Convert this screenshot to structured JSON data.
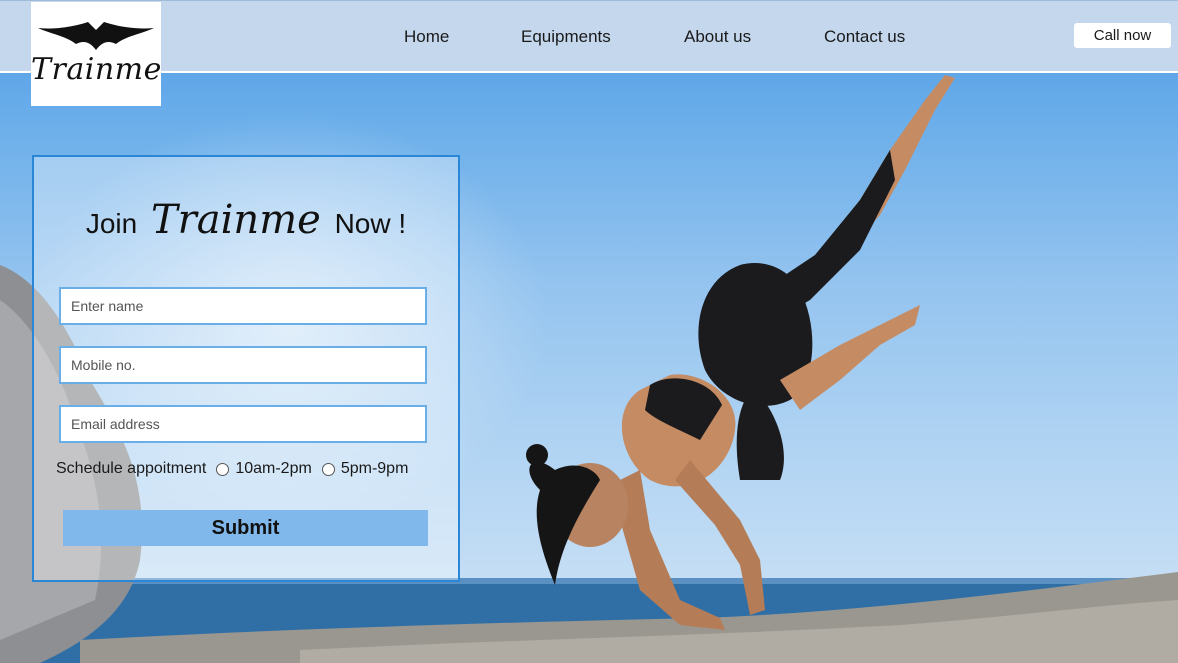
{
  "header": {
    "logo_text": "Trainme",
    "nav": [
      {
        "label": "Home"
      },
      {
        "label": "Equipments"
      },
      {
        "label": "About us"
      },
      {
        "label": "Contact us"
      }
    ],
    "call_button": "Call now"
  },
  "form": {
    "title_prefix": "Join",
    "title_brand": "Trainme",
    "title_suffix": "Now !",
    "name_placeholder": "Enter name",
    "mobile_placeholder": "Mobile no.",
    "email_placeholder": "Email address",
    "schedule_label": "Schedule appoitment",
    "slots": [
      "10am-2pm",
      "5pm-9pm"
    ],
    "submit_label": "Submit"
  },
  "colors": {
    "header_bg": "#c4d7ed",
    "form_border": "#2a86d6",
    "field_border": "#6aaee8",
    "submit_bg": "#80b8ec"
  },
  "icons": {
    "logo": "bat-wing-logo-icon"
  }
}
